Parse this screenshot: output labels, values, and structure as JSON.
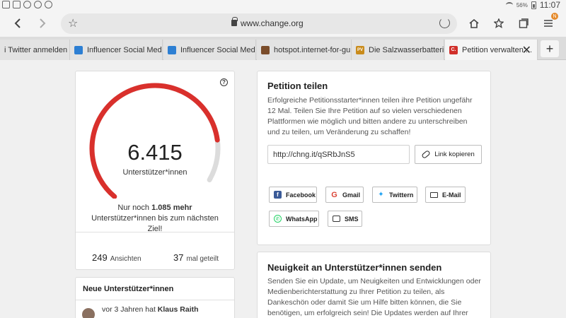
{
  "status_bar": {
    "battery_pct": "56%",
    "time": "11:07"
  },
  "toolbar": {
    "url": "www.change.org"
  },
  "tabs": [
    {
      "title": "i Twitter anmelden /...",
      "favicon": "none"
    },
    {
      "title": "Influencer Social Medi...",
      "favicon": "doc-icon"
    },
    {
      "title": "Influencer Social Medi...",
      "favicon": "doc-icon"
    },
    {
      "title": "hotspot.internet-for-gu...",
      "favicon": "hotspot-icon"
    },
    {
      "title": "Die Salzwasserbatteri...",
      "favicon": "pv-icon"
    },
    {
      "title": "Petition verwalten:...",
      "favicon": "change-icon"
    }
  ],
  "favicon_text": {
    "pv": "PV",
    "change": "C."
  },
  "stats": {
    "signature_count": "6.415",
    "signature_label": "Unterstützer*innen",
    "goal_prefix": "Nur noch ",
    "goal_remaining": "1.085 mehr",
    "goal_suffix": "Unterstützer*innen bis zum nächsten Ziel!",
    "views_count": "249",
    "views_label": "Ansichten",
    "shares_count": "37",
    "shares_label": "mal geteilt",
    "progress_fraction": 0.855,
    "accent_color": "#d9302c"
  },
  "share_card": {
    "title": "Petition teilen",
    "body": "Erfolgreiche Petitionsstarter*innen teilen ihre Petition ungefähr 12 Mal. Teilen Sie Ihre Petition auf so vielen verschiedenen Plattformen wie möglich und bitten andere zu unterschreiben und zu teilen, um Veränderung zu schaffen!",
    "short_link": "http://chng.it/qSRbJnS5",
    "copy_label": "Link kopieren",
    "buttons": [
      "Facebook",
      "Gmail",
      "Twittern",
      "E-Mail",
      "WhatsApp",
      "SMS"
    ]
  },
  "supporters_card": {
    "title": "Neue Unterstützer*innen",
    "entry_prefix": "vor 3 Jahren hat ",
    "entry_name": "Klaus Raith"
  },
  "news_card": {
    "title": "Neuigkeit an Unterstützer*innen senden",
    "body": "Senden Sie ein Update, um Neuigkeiten und Entwicklungen oder Medienberichterstattung zu Ihrer Petition zu teilen, als Dankeschön oder damit Sie um Hilfe bitten können, die Sie benötigen, um erfolgreich sein! Die Updates werden auf Ihrer Petitionsseite"
  }
}
